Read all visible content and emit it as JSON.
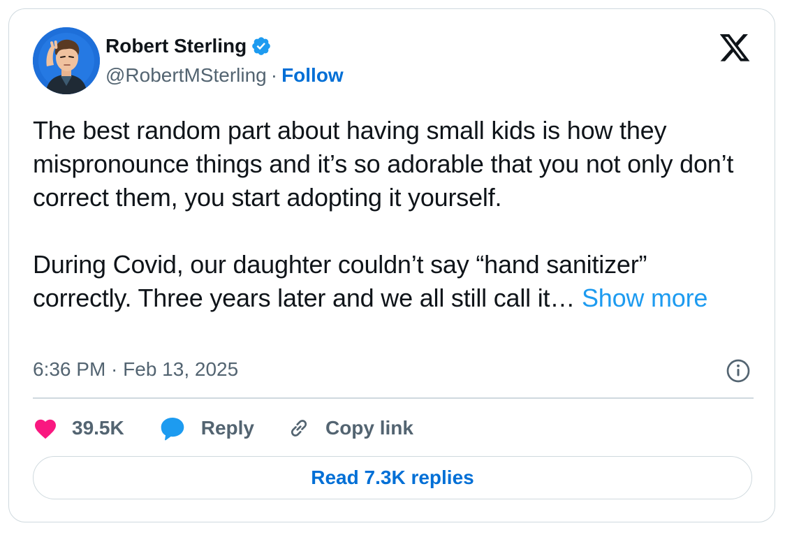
{
  "author": {
    "name": "Robert Sterling",
    "handle": "@RobertMSterling",
    "separator": "·",
    "follow_label": "Follow",
    "verified": true,
    "avatar_icon": "cartoon-avatar"
  },
  "brand": {
    "logo_icon": "x-logo-icon"
  },
  "tweet": {
    "paragraph1": "The best random part about having small kids is how they mispronounce things and it’s so adorable that you not only don’t correct them, you start adopting it yourself.",
    "paragraph2_line1": "During Covid, our daughter couldn’t say “hand sanitizer”",
    "paragraph2_line2": "correctly. Three years later and we all still call it…",
    "show_more_label": "Show more"
  },
  "meta": {
    "timestamp": "6:36 PM · Feb 13, 2025",
    "info_icon": "info-icon"
  },
  "actions": {
    "like_count": "39.5K",
    "reply_label": "Reply",
    "copy_link_label": "Copy link"
  },
  "footer": {
    "read_replies_label": "Read 7.3K replies"
  },
  "colors": {
    "accent": "#1d9bf0",
    "link_blue": "#006fd6",
    "heart": "#f91880",
    "muted": "#536471",
    "border": "#cfd9de"
  }
}
